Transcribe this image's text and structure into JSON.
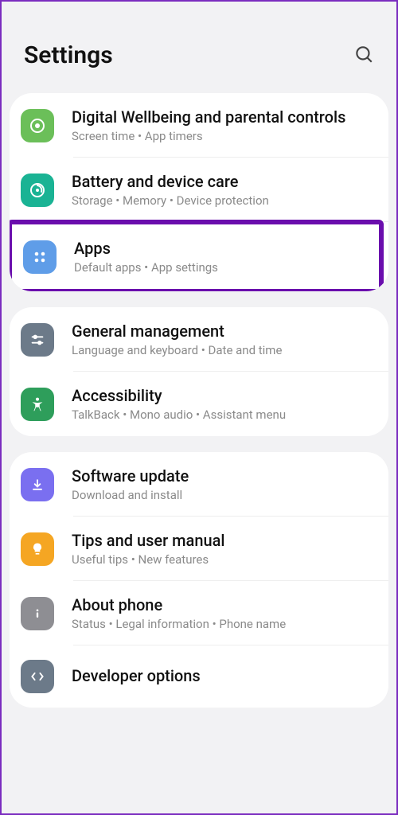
{
  "header": {
    "title": "Settings"
  },
  "items": [
    {
      "title": "Digital Wellbeing and parental controls",
      "subtitle": "Screen time  •  App timers"
    },
    {
      "title": "Battery and device care",
      "subtitle": "Storage  •  Memory  •  Device protection"
    },
    {
      "title": "Apps",
      "subtitle": "Default apps  •  App settings"
    },
    {
      "title": "General management",
      "subtitle": "Language and keyboard  •  Date and time"
    },
    {
      "title": "Accessibility",
      "subtitle": "TalkBack  •  Mono audio  •  Assistant menu"
    },
    {
      "title": "Software update",
      "subtitle": "Download and install"
    },
    {
      "title": "Tips and user manual",
      "subtitle": "Useful tips  •  New features"
    },
    {
      "title": "About phone",
      "subtitle": "Status  •  Legal information  •  Phone name"
    },
    {
      "title": "Developer options",
      "subtitle": ""
    }
  ]
}
